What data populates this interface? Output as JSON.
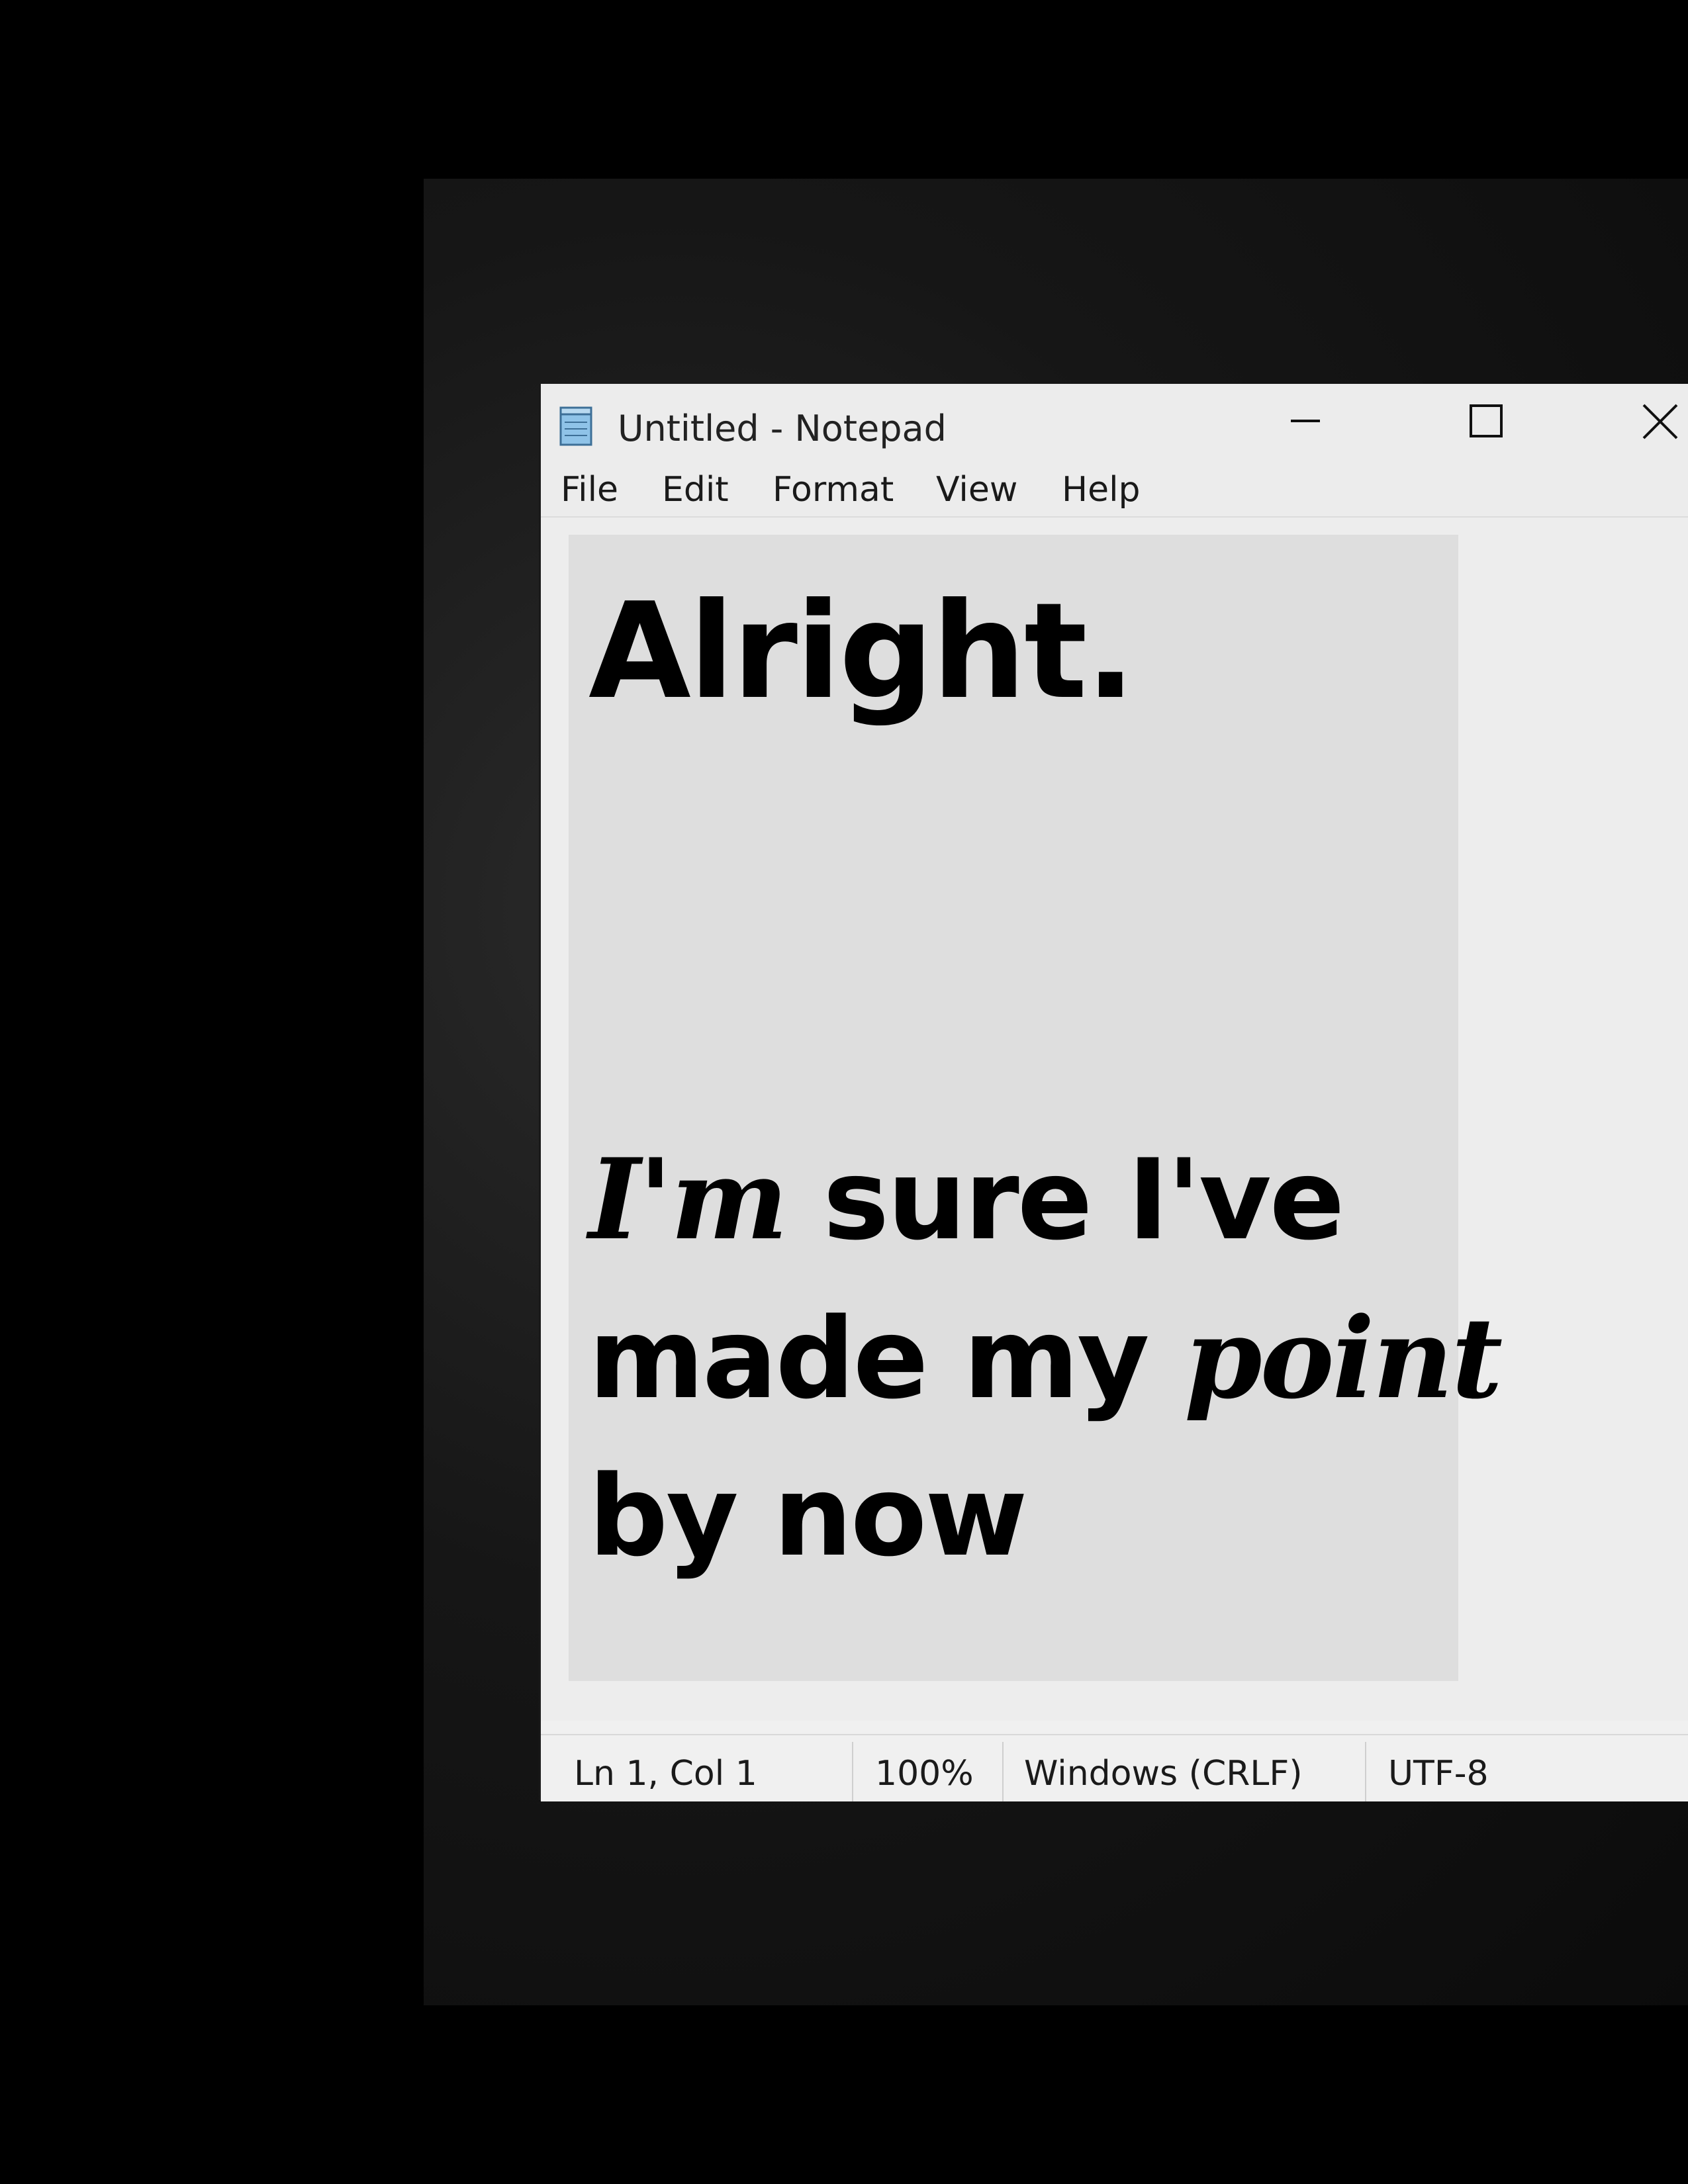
{
  "window": {
    "title": "Untitled - Notepad",
    "icons": {
      "app": "notepad-icon",
      "minimize": "minimize-icon",
      "maximize": "maximize-icon",
      "close": "close-icon"
    }
  },
  "menu": {
    "items": [
      "File",
      "Edit",
      "Format",
      "View",
      "Help"
    ]
  },
  "editor": {
    "lines": {
      "line1": "Alright.",
      "line2_fancy": "I'm",
      "line2_rest": " sure I've",
      "line3_start": "made my ",
      "line3_fancy": "point",
      "line4": "by now"
    }
  },
  "status": {
    "position": "Ln 1, Col 1",
    "zoom": "100%",
    "line_ending": "Windows (CRLF)",
    "encoding": "UTF-8"
  }
}
